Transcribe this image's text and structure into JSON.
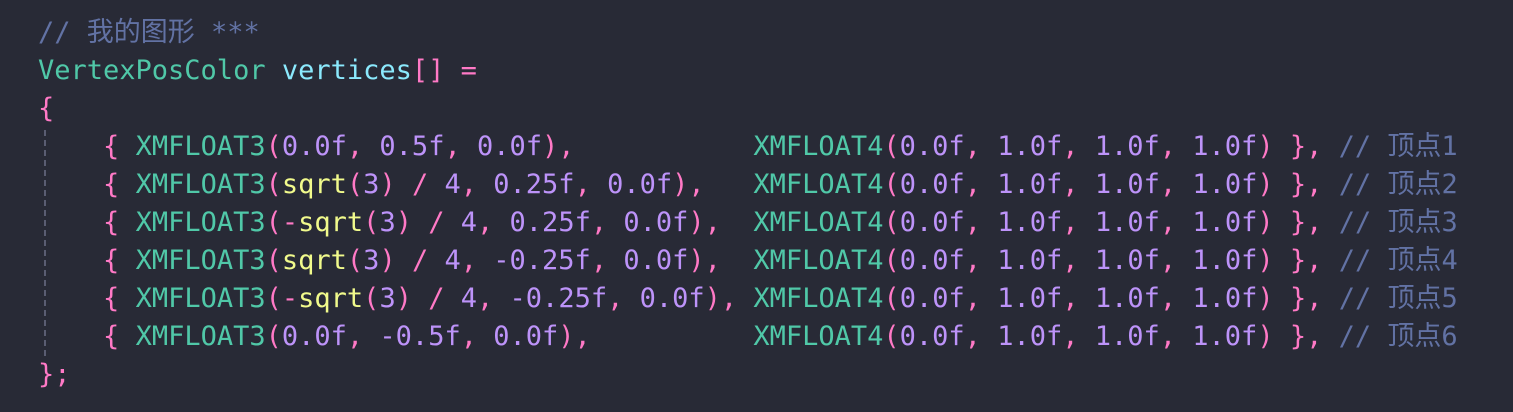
{
  "colors": {
    "background": "#282a36",
    "comment": "#6272a4",
    "type": "#50c8a8",
    "variable": "#8be9fd",
    "punctuation": "#ff79c6",
    "number": "#bd93f9",
    "function": "#f1fa8c",
    "text": "#f8f8f2"
  },
  "lines": [
    [
      {
        "t": "// 我的图形 ***",
        "c": "comment"
      }
    ],
    [
      {
        "t": "VertexPosColor",
        "c": "type"
      },
      {
        "t": " ",
        "c": "plain"
      },
      {
        "t": "vertices",
        "c": "var"
      },
      {
        "t": "[]",
        "c": "punc"
      },
      {
        "t": " ",
        "c": "plain"
      },
      {
        "t": "=",
        "c": "op"
      }
    ],
    [
      {
        "t": "{",
        "c": "punc"
      }
    ],
    [
      {
        "t": "    ",
        "c": "plain"
      },
      {
        "t": "{",
        "c": "punc"
      },
      {
        "t": " ",
        "c": "plain"
      },
      {
        "t": "XMFLOAT3",
        "c": "type"
      },
      {
        "t": "(",
        "c": "punc"
      },
      {
        "t": "0.0f",
        "c": "num"
      },
      {
        "t": ", ",
        "c": "punc"
      },
      {
        "t": "0.5f",
        "c": "num"
      },
      {
        "t": ", ",
        "c": "punc"
      },
      {
        "t": "0.0f",
        "c": "num"
      },
      {
        "t": "),",
        "c": "punc"
      },
      {
        "t": "           ",
        "c": "plain"
      },
      {
        "t": "XMFLOAT4",
        "c": "type"
      },
      {
        "t": "(",
        "c": "punc"
      },
      {
        "t": "0.0f",
        "c": "num"
      },
      {
        "t": ", ",
        "c": "punc"
      },
      {
        "t": "1.0f",
        "c": "num"
      },
      {
        "t": ", ",
        "c": "punc"
      },
      {
        "t": "1.0f",
        "c": "num"
      },
      {
        "t": ", ",
        "c": "punc"
      },
      {
        "t": "1.0f",
        "c": "num"
      },
      {
        "t": ")",
        "c": "punc"
      },
      {
        "t": " ",
        "c": "plain"
      },
      {
        "t": "},",
        "c": "punc"
      },
      {
        "t": " ",
        "c": "plain"
      },
      {
        "t": "// 顶点1",
        "c": "comment"
      }
    ],
    [
      {
        "t": "    ",
        "c": "plain"
      },
      {
        "t": "{",
        "c": "punc"
      },
      {
        "t": " ",
        "c": "plain"
      },
      {
        "t": "XMFLOAT3",
        "c": "type"
      },
      {
        "t": "(",
        "c": "punc"
      },
      {
        "t": "sqrt",
        "c": "func"
      },
      {
        "t": "(",
        "c": "punc"
      },
      {
        "t": "3",
        "c": "num"
      },
      {
        "t": ")",
        "c": "punc"
      },
      {
        "t": " ",
        "c": "plain"
      },
      {
        "t": "/",
        "c": "op"
      },
      {
        "t": " ",
        "c": "plain"
      },
      {
        "t": "4",
        "c": "num"
      },
      {
        "t": ", ",
        "c": "punc"
      },
      {
        "t": "0.25f",
        "c": "num"
      },
      {
        "t": ", ",
        "c": "punc"
      },
      {
        "t": "0.0f",
        "c": "num"
      },
      {
        "t": "),",
        "c": "punc"
      },
      {
        "t": "   ",
        "c": "plain"
      },
      {
        "t": "XMFLOAT4",
        "c": "type"
      },
      {
        "t": "(",
        "c": "punc"
      },
      {
        "t": "0.0f",
        "c": "num"
      },
      {
        "t": ", ",
        "c": "punc"
      },
      {
        "t": "1.0f",
        "c": "num"
      },
      {
        "t": ", ",
        "c": "punc"
      },
      {
        "t": "1.0f",
        "c": "num"
      },
      {
        "t": ", ",
        "c": "punc"
      },
      {
        "t": "1.0f",
        "c": "num"
      },
      {
        "t": ")",
        "c": "punc"
      },
      {
        "t": " ",
        "c": "plain"
      },
      {
        "t": "},",
        "c": "punc"
      },
      {
        "t": " ",
        "c": "plain"
      },
      {
        "t": "// 顶点2",
        "c": "comment"
      }
    ],
    [
      {
        "t": "    ",
        "c": "plain"
      },
      {
        "t": "{",
        "c": "punc"
      },
      {
        "t": " ",
        "c": "plain"
      },
      {
        "t": "XMFLOAT3",
        "c": "type"
      },
      {
        "t": "(",
        "c": "punc"
      },
      {
        "t": "-",
        "c": "op"
      },
      {
        "t": "sqrt",
        "c": "func"
      },
      {
        "t": "(",
        "c": "punc"
      },
      {
        "t": "3",
        "c": "num"
      },
      {
        "t": ")",
        "c": "punc"
      },
      {
        "t": " ",
        "c": "plain"
      },
      {
        "t": "/",
        "c": "op"
      },
      {
        "t": " ",
        "c": "plain"
      },
      {
        "t": "4",
        "c": "num"
      },
      {
        "t": ", ",
        "c": "punc"
      },
      {
        "t": "0.25f",
        "c": "num"
      },
      {
        "t": ", ",
        "c": "punc"
      },
      {
        "t": "0.0f",
        "c": "num"
      },
      {
        "t": "),",
        "c": "punc"
      },
      {
        "t": "  ",
        "c": "plain"
      },
      {
        "t": "XMFLOAT4",
        "c": "type"
      },
      {
        "t": "(",
        "c": "punc"
      },
      {
        "t": "0.0f",
        "c": "num"
      },
      {
        "t": ", ",
        "c": "punc"
      },
      {
        "t": "1.0f",
        "c": "num"
      },
      {
        "t": ", ",
        "c": "punc"
      },
      {
        "t": "1.0f",
        "c": "num"
      },
      {
        "t": ", ",
        "c": "punc"
      },
      {
        "t": "1.0f",
        "c": "num"
      },
      {
        "t": ")",
        "c": "punc"
      },
      {
        "t": " ",
        "c": "plain"
      },
      {
        "t": "},",
        "c": "punc"
      },
      {
        "t": " ",
        "c": "plain"
      },
      {
        "t": "// 顶点3",
        "c": "comment"
      }
    ],
    [
      {
        "t": "    ",
        "c": "plain"
      },
      {
        "t": "{",
        "c": "punc"
      },
      {
        "t": " ",
        "c": "plain"
      },
      {
        "t": "XMFLOAT3",
        "c": "type"
      },
      {
        "t": "(",
        "c": "punc"
      },
      {
        "t": "sqrt",
        "c": "func"
      },
      {
        "t": "(",
        "c": "punc"
      },
      {
        "t": "3",
        "c": "num"
      },
      {
        "t": ")",
        "c": "punc"
      },
      {
        "t": " ",
        "c": "plain"
      },
      {
        "t": "/",
        "c": "op"
      },
      {
        "t": " ",
        "c": "plain"
      },
      {
        "t": "4",
        "c": "num"
      },
      {
        "t": ", ",
        "c": "punc"
      },
      {
        "t": "-0.25f",
        "c": "num"
      },
      {
        "t": ", ",
        "c": "punc"
      },
      {
        "t": "0.0f",
        "c": "num"
      },
      {
        "t": "),",
        "c": "punc"
      },
      {
        "t": "  ",
        "c": "plain"
      },
      {
        "t": "XMFLOAT4",
        "c": "type"
      },
      {
        "t": "(",
        "c": "punc"
      },
      {
        "t": "0.0f",
        "c": "num"
      },
      {
        "t": ", ",
        "c": "punc"
      },
      {
        "t": "1.0f",
        "c": "num"
      },
      {
        "t": ", ",
        "c": "punc"
      },
      {
        "t": "1.0f",
        "c": "num"
      },
      {
        "t": ", ",
        "c": "punc"
      },
      {
        "t": "1.0f",
        "c": "num"
      },
      {
        "t": ")",
        "c": "punc"
      },
      {
        "t": " ",
        "c": "plain"
      },
      {
        "t": "},",
        "c": "punc"
      },
      {
        "t": " ",
        "c": "plain"
      },
      {
        "t": "// 顶点4",
        "c": "comment"
      }
    ],
    [
      {
        "t": "    ",
        "c": "plain"
      },
      {
        "t": "{",
        "c": "punc"
      },
      {
        "t": " ",
        "c": "plain"
      },
      {
        "t": "XMFLOAT3",
        "c": "type"
      },
      {
        "t": "(",
        "c": "punc"
      },
      {
        "t": "-",
        "c": "op"
      },
      {
        "t": "sqrt",
        "c": "func"
      },
      {
        "t": "(",
        "c": "punc"
      },
      {
        "t": "3",
        "c": "num"
      },
      {
        "t": ")",
        "c": "punc"
      },
      {
        "t": " ",
        "c": "plain"
      },
      {
        "t": "/",
        "c": "op"
      },
      {
        "t": " ",
        "c": "plain"
      },
      {
        "t": "4",
        "c": "num"
      },
      {
        "t": ", ",
        "c": "punc"
      },
      {
        "t": "-0.25f",
        "c": "num"
      },
      {
        "t": ", ",
        "c": "punc"
      },
      {
        "t": "0.0f",
        "c": "num"
      },
      {
        "t": "),",
        "c": "punc"
      },
      {
        "t": " ",
        "c": "plain"
      },
      {
        "t": "XMFLOAT4",
        "c": "type"
      },
      {
        "t": "(",
        "c": "punc"
      },
      {
        "t": "0.0f",
        "c": "num"
      },
      {
        "t": ", ",
        "c": "punc"
      },
      {
        "t": "1.0f",
        "c": "num"
      },
      {
        "t": ", ",
        "c": "punc"
      },
      {
        "t": "1.0f",
        "c": "num"
      },
      {
        "t": ", ",
        "c": "punc"
      },
      {
        "t": "1.0f",
        "c": "num"
      },
      {
        "t": ")",
        "c": "punc"
      },
      {
        "t": " ",
        "c": "plain"
      },
      {
        "t": "},",
        "c": "punc"
      },
      {
        "t": " ",
        "c": "plain"
      },
      {
        "t": "// 顶点5",
        "c": "comment"
      }
    ],
    [
      {
        "t": "    ",
        "c": "plain"
      },
      {
        "t": "{",
        "c": "punc"
      },
      {
        "t": " ",
        "c": "plain"
      },
      {
        "t": "XMFLOAT3",
        "c": "type"
      },
      {
        "t": "(",
        "c": "punc"
      },
      {
        "t": "0.0f",
        "c": "num"
      },
      {
        "t": ", ",
        "c": "punc"
      },
      {
        "t": "-0.5f",
        "c": "num"
      },
      {
        "t": ", ",
        "c": "punc"
      },
      {
        "t": "0.0f",
        "c": "num"
      },
      {
        "t": "),",
        "c": "punc"
      },
      {
        "t": "          ",
        "c": "plain"
      },
      {
        "t": "XMFLOAT4",
        "c": "type"
      },
      {
        "t": "(",
        "c": "punc"
      },
      {
        "t": "0.0f",
        "c": "num"
      },
      {
        "t": ", ",
        "c": "punc"
      },
      {
        "t": "1.0f",
        "c": "num"
      },
      {
        "t": ", ",
        "c": "punc"
      },
      {
        "t": "1.0f",
        "c": "num"
      },
      {
        "t": ", ",
        "c": "punc"
      },
      {
        "t": "1.0f",
        "c": "num"
      },
      {
        "t": ")",
        "c": "punc"
      },
      {
        "t": " ",
        "c": "plain"
      },
      {
        "t": "},",
        "c": "punc"
      },
      {
        "t": " ",
        "c": "plain"
      },
      {
        "t": "// 顶点6",
        "c": "comment"
      }
    ],
    [
      {
        "t": "};",
        "c": "punc"
      }
    ]
  ]
}
